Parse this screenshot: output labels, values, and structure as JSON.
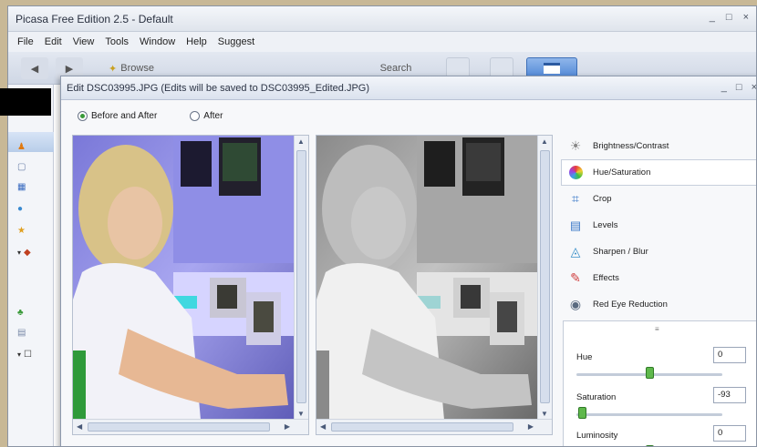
{
  "app": {
    "title": "Picasa Free Edition 2.5 - Default",
    "window_controls": [
      "_",
      "□",
      "×"
    ]
  },
  "menu": [
    "File",
    "Edit",
    "View",
    "Tools",
    "Window",
    "Help",
    "Suggest"
  ],
  "toolbar": {
    "browse_label": "Browse",
    "search_label": "Search"
  },
  "dialog": {
    "title": "Edit DSC03995.JPG (Edits will be saved to DSC03995_Edited.JPG)",
    "controls": [
      "_",
      "□",
      "×"
    ],
    "view_options": [
      {
        "label": "Before and After",
        "selected": true
      },
      {
        "label": "After",
        "selected": false
      }
    ]
  },
  "tools": [
    {
      "label": "Brightness/Contrast",
      "icon": "sun-icon",
      "active": false
    },
    {
      "label": "Hue/Saturation",
      "icon": "color-wheel-icon",
      "active": true
    },
    {
      "label": "Crop",
      "icon": "crop-icon",
      "active": false
    },
    {
      "label": "Levels",
      "icon": "levels-icon",
      "active": false
    },
    {
      "label": "Sharpen / Blur",
      "icon": "sharpen-icon",
      "active": false
    },
    {
      "label": "Effects",
      "icon": "effects-icon",
      "active": false
    },
    {
      "label": "Red Eye Reduction",
      "icon": "red-eye-icon",
      "active": false
    }
  ],
  "adjustments": {
    "hue": {
      "label": "Hue",
      "value": "0",
      "level": 0.5
    },
    "saturation": {
      "label": "Saturation",
      "value": "-93",
      "level": 0.04
    },
    "luminosity": {
      "label": "Luminosity",
      "value": "0",
      "level": 0.5
    }
  },
  "colors": {
    "accent_green": "#5fb84c",
    "titlebar": "#dbe2ee",
    "toolbar_active": "#4e86d6",
    "background": "#c8b896"
  }
}
